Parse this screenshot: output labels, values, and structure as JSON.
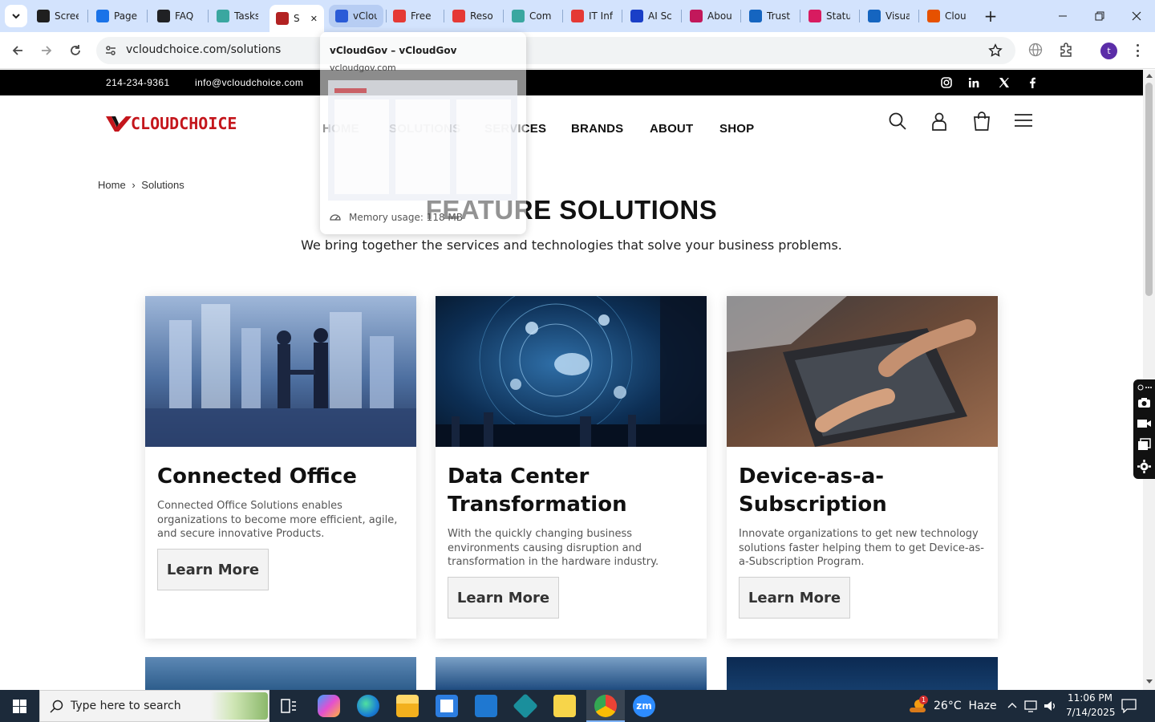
{
  "browser": {
    "tabs": [
      {
        "title": "Scree",
        "color": "#1f1f1f",
        "icon": "camera-icon"
      },
      {
        "title": "Page",
        "color": "#1a73e8",
        "icon": "gauge-icon"
      },
      {
        "title": "FAQ",
        "color": "#202124",
        "icon": "openai-icon"
      },
      {
        "title": "Tasks",
        "color": "#3aa7a0",
        "icon": "tasks-icon"
      },
      {
        "title": "S",
        "color": "#b22222",
        "icon": "vcloud-icon"
      },
      {
        "title": "vClou",
        "color": "#2a5bd7",
        "icon": "vcloudgov-icon"
      },
      {
        "title": "Free",
        "color": "#e53935",
        "icon": "diamond-icon"
      },
      {
        "title": "Reso",
        "color": "#e53935",
        "icon": "diamond-icon"
      },
      {
        "title": "Com",
        "color": "#3aa7a0",
        "icon": "tasks-icon"
      },
      {
        "title": "IT Inf",
        "color": "#e53935",
        "icon": "diamond-icon"
      },
      {
        "title": "AI Sc",
        "color": "#1a3fc7",
        "icon": "x-logo-icon"
      },
      {
        "title": "Abou",
        "color": "#c2185b",
        "icon": "ring-icon"
      },
      {
        "title": "Trust",
        "color": "#1565c0",
        "icon": "scale-icon"
      },
      {
        "title": "Statu",
        "color": "#d81b60",
        "icon": "pen-icon"
      },
      {
        "title": "Visua",
        "color": "#1565c0",
        "icon": "pulse-icon"
      },
      {
        "title": "Clou",
        "color": "#e65100",
        "icon": "swoosh-icon"
      }
    ],
    "url": "vcloudchoice.com/solutions",
    "profile_initial": "t",
    "preview": {
      "title": "vCloudGov – vCloudGov",
      "domain": "vcloudgov.com",
      "memory": "Memory usage: 118 MB"
    }
  },
  "site": {
    "phone": "214-234-9361",
    "email": "info@vcloudchoice.com",
    "logo_text": "CLOUDCHOICE",
    "nav": [
      "HOME",
      "SOLUTIONS",
      "SERVICES",
      "BRANDS",
      "ABOUT",
      "SHOP"
    ],
    "breadcrumb": {
      "home": "Home",
      "sep": "›",
      "current": "Solutions"
    },
    "title": "FEATURE SOLUTIONS",
    "subtitle": "We bring together the services and technologies that solve your business problems.",
    "cards": [
      {
        "title": "Connected Office",
        "desc": "Connected Office Solutions enables organizations to become more efficient, agile, and secure innovative Products.",
        "button": "Learn More"
      },
      {
        "title": "Data Center Transformation",
        "desc": "With the quickly changing business environments causing disruption and transformation in the hardware industry.",
        "button": "Learn More"
      },
      {
        "title": "Device-as-a-Subscription",
        "desc": "Innovate organizations to get new technology solutions faster helping them to get Device-as-a-Subscription Program.",
        "button": "Learn More"
      }
    ]
  },
  "taskbar": {
    "search_placeholder": "Type here to search",
    "weather": "26°C  Haze",
    "time": "11:06 PM",
    "date": "7/14/2025",
    "weather_badge": "1"
  }
}
